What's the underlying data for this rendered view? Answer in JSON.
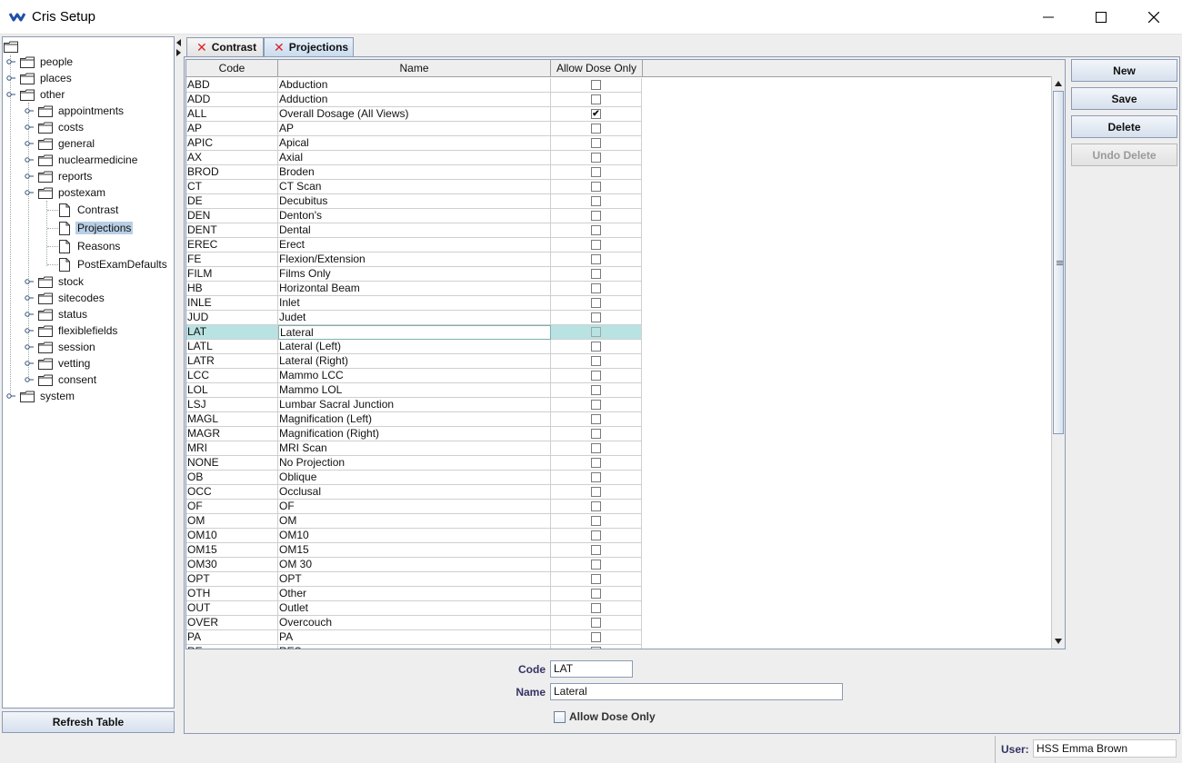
{
  "window": {
    "title": "Cris Setup"
  },
  "tree": {
    "top_level": [
      {
        "label": "people"
      },
      {
        "label": "places"
      },
      {
        "label": "other"
      }
    ],
    "other_children": [
      {
        "label": "appointments"
      },
      {
        "label": "costs"
      },
      {
        "label": "general"
      },
      {
        "label": "nuclearmedicine"
      },
      {
        "label": "reports"
      },
      {
        "label": "postexam"
      }
    ],
    "postexam_children": [
      {
        "label": "Contrast"
      },
      {
        "label": "Projections"
      },
      {
        "label": "Reasons"
      },
      {
        "label": "PostExamDefaults"
      }
    ],
    "other_children_after": [
      {
        "label": "stock"
      },
      {
        "label": "sitecodes"
      },
      {
        "label": "status"
      },
      {
        "label": "flexiblefields"
      },
      {
        "label": "session"
      },
      {
        "label": "vetting"
      },
      {
        "label": "consent"
      }
    ],
    "system": {
      "label": "system"
    },
    "selected": "Projections"
  },
  "refresh_label": "Refresh Table",
  "tabs": [
    {
      "label": "Contrast",
      "active": false
    },
    {
      "label": "Projections",
      "active": true
    }
  ],
  "table": {
    "headers": [
      "Code",
      "Name",
      "Allow Dose Only"
    ],
    "rows": [
      [
        "ABD",
        "Abduction",
        false
      ],
      [
        "ADD",
        "Adduction",
        false
      ],
      [
        "ALL",
        "Overall Dosage (All Views)",
        true
      ],
      [
        "AP",
        "AP",
        false
      ],
      [
        "APIC",
        "Apical",
        false
      ],
      [
        "AX",
        "Axial",
        false
      ],
      [
        "BROD",
        "Broden",
        false
      ],
      [
        "CT",
        "CT Scan",
        false
      ],
      [
        "DE",
        "Decubitus",
        false
      ],
      [
        "DEN",
        "Denton's",
        false
      ],
      [
        "DENT",
        "Dental",
        false
      ],
      [
        "EREC",
        "Erect",
        false
      ],
      [
        "FE",
        "Flexion/Extension",
        false
      ],
      [
        "FILM",
        "Films Only",
        false
      ],
      [
        "HB",
        "Horizontal Beam",
        false
      ],
      [
        "INLE",
        "Inlet",
        false
      ],
      [
        "JUD",
        "Judet",
        false
      ],
      [
        "LAT",
        "Lateral",
        false
      ],
      [
        "LATL",
        "Lateral (Left)",
        false
      ],
      [
        "LATR",
        "Lateral (Right)",
        false
      ],
      [
        "LCC",
        "Mammo LCC",
        false
      ],
      [
        "LOL",
        "Mammo LOL",
        false
      ],
      [
        "LSJ",
        "Lumbar Sacral Junction",
        false
      ],
      [
        "MAGL",
        "Magnification (Left)",
        false
      ],
      [
        "MAGR",
        "Magnification (Right)",
        false
      ],
      [
        "MRI",
        "MRI Scan",
        false
      ],
      [
        "NONE",
        "No Projection",
        false
      ],
      [
        "OB",
        "Oblique",
        false
      ],
      [
        "OCC",
        "Occlusal",
        false
      ],
      [
        "OF",
        "OF",
        false
      ],
      [
        "OM",
        "OM",
        false
      ],
      [
        "OM10",
        "OM10",
        false
      ],
      [
        "OM15",
        "OM15",
        false
      ],
      [
        "OM30",
        "OM 30",
        false
      ],
      [
        "OPT",
        "OPT",
        false
      ],
      [
        "OTH",
        "Other",
        false
      ],
      [
        "OUT",
        "Outlet",
        false
      ],
      [
        "OVER",
        "Overcouch",
        false
      ],
      [
        "PA",
        "PA",
        false
      ],
      [
        "RE",
        "RES",
        false
      ]
    ],
    "selected_index": 17
  },
  "buttons": {
    "new": "New",
    "save": "Save",
    "delete": "Delete",
    "undo_delete": "Undo Delete"
  },
  "form": {
    "code_label": "Code",
    "code_value": "LAT",
    "name_label": "Name",
    "name_value": "Lateral",
    "allow_dose_label": "Allow Dose Only"
  },
  "status": {
    "user_label": "User:",
    "user_value": "HSS Emma Brown"
  },
  "icons": {
    "app": "app-logo-icon",
    "minimize": "minimize-icon",
    "maximize": "maximize-icon",
    "close": "close-icon",
    "folder": "folder-icon",
    "document": "document-icon",
    "tab_close": "tab-close-icon"
  },
  "colors": {
    "selection_row": "#b9e3e3",
    "tree_selection": "#b8cfe5",
    "tab_close": "#dd2222",
    "form_label": "#333366"
  }
}
